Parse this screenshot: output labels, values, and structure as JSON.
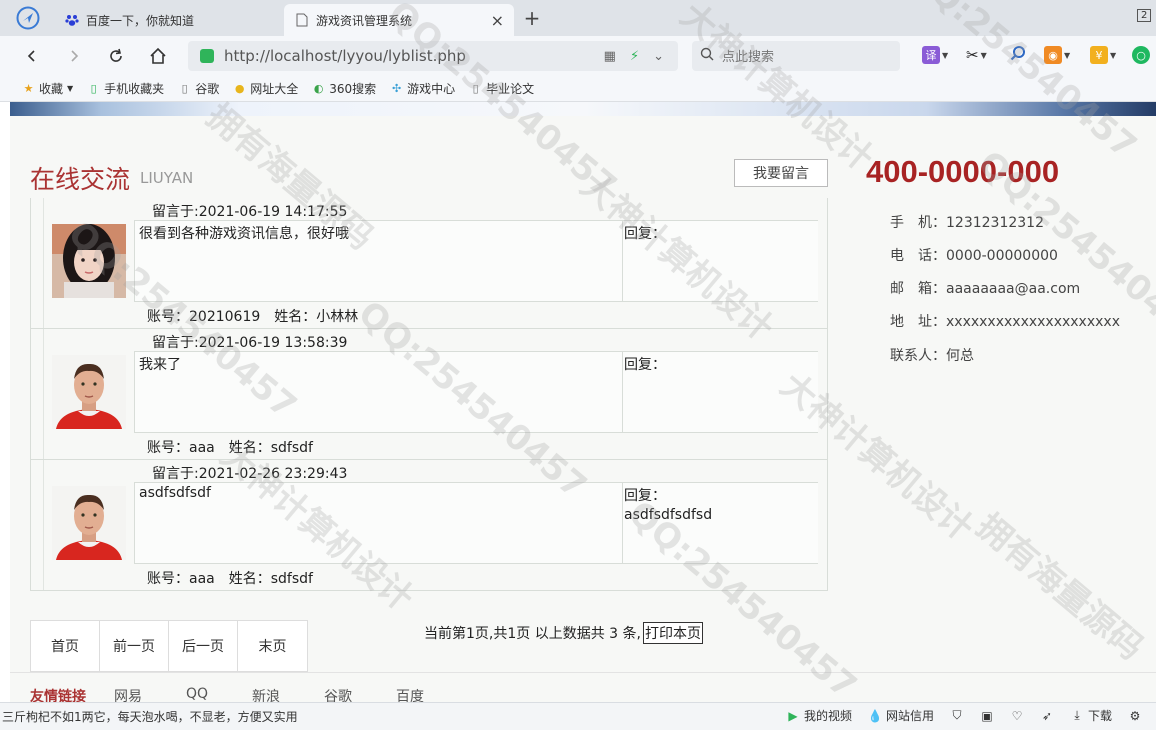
{
  "browser": {
    "tabs": [
      {
        "title": "百度一下，你就知道",
        "active": false
      },
      {
        "title": "游戏资讯管理系统",
        "active": true
      }
    ],
    "tab_count": "2",
    "url": "http://localhost/lyyou/lyblist.php",
    "search_placeholder": "点此搜索",
    "ext_translate": "译",
    "bookmarks": [
      "收藏",
      "手机收藏夹",
      "谷歌",
      "网址大全",
      "360搜索",
      "游戏中心",
      "毕业论文"
    ]
  },
  "page": {
    "section_title": "在线交流",
    "section_sub": "LIUYAN",
    "leave_message_button": "我要留言",
    "messages": [
      {
        "date": "留言于:2021-06-19 14:17:55",
        "content": "很看到各种游戏资讯信息，很好哦",
        "reply_label": "回复：",
        "reply": "",
        "account": "账号：20210619",
        "name": "姓名：小林林",
        "avatar": "female"
      },
      {
        "date": "留言于:2021-06-19 13:58:39",
        "content": "我来了",
        "reply_label": "回复：",
        "reply": "",
        "account": "账号：aaa",
        "name": "姓名：sdfsdf",
        "avatar": "male"
      },
      {
        "date": "留言于:2021-02-26 23:29:43",
        "content": "asdfsdfsdf",
        "reply_label": "回复：",
        "reply": "asdfsdfsdfsd",
        "account": "账号：aaa",
        "name": "姓名：sdfsdf",
        "avatar": "male"
      }
    ],
    "contact": {
      "hotline": "400-0000-000",
      "mobile": "手　机：12312312312",
      "tel": "电　话：0000-00000000",
      "email": "邮　箱：aaaaaaaa@aa.com",
      "address": "地　址：xxxxxxxxxxxxxxxxxxxxx",
      "person": "联系人：何总"
    },
    "pager": {
      "first": "首页",
      "prev": "前一页",
      "next": "后一页",
      "last": "末页",
      "info": "当前第1页,共1页 以上数据共 3 条,",
      "print": "打印本页"
    },
    "links": {
      "title": "友情链接",
      "items": [
        "网易",
        "QQ",
        "新浪",
        "谷歌",
        "百度"
      ]
    }
  },
  "watermarks": [
    "QQ:254540457",
    "大神计算机设计",
    "拥有海量源码"
  ],
  "statusbar": {
    "news": "三斤枸杞不如1两它，每天泡水喝，不显老，方便又实用",
    "video": "我的视频",
    "credit": "网站信用",
    "download": "下载"
  }
}
